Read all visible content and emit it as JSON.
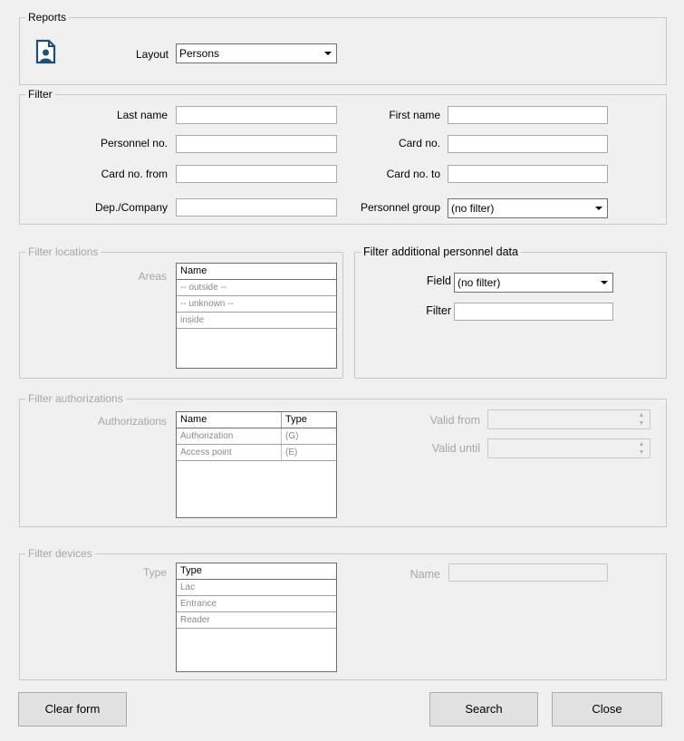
{
  "reports": {
    "legend": "Reports",
    "icon": "person-report-icon",
    "layout_label": "Layout",
    "layout_value": "Persons"
  },
  "filter": {
    "legend": "Filter",
    "last_name_label": "Last name",
    "first_name_label": "First name",
    "personnel_no_label": "Personnel no.",
    "card_no_label": "Card no.",
    "card_no_from_label": "Card no. from",
    "card_no_to_label": "Card no. to",
    "dep_company_label": "Dep./Company",
    "personnel_group_label": "Personnel group",
    "personnel_group_value": "(no filter)"
  },
  "filter_locations": {
    "legend": "Filter locations",
    "areas_label": "Areas",
    "column": "Name",
    "rows": [
      "-- outside --",
      "-- unknown --",
      "inside"
    ]
  },
  "filter_additional": {
    "legend": "Filter additional personnel data",
    "field_label": "Field",
    "field_value": "(no filter)",
    "filter_label": "Filter"
  },
  "filter_authorizations": {
    "legend": "Filter authorizations",
    "authorizations_label": "Authorizations",
    "columns": [
      "Name",
      "Type"
    ],
    "rows": [
      {
        "name": "Authorization",
        "type": "(G)"
      },
      {
        "name": "Access point",
        "type": "(E)"
      }
    ],
    "valid_from_label": "Valid from",
    "valid_until_label": "Valid until"
  },
  "filter_devices": {
    "legend": "Filter devices",
    "type_label": "Type",
    "column": "Type",
    "rows": [
      "Lac",
      "Entrance",
      "Reader"
    ],
    "name_label": "Name"
  },
  "buttons": {
    "clear_form": "Clear form",
    "search": "Search",
    "close": "Close"
  },
  "colors": {
    "background": "#f0f0f0",
    "disabled_text": "#a6a6a6",
    "icon": "#1f4e79"
  }
}
